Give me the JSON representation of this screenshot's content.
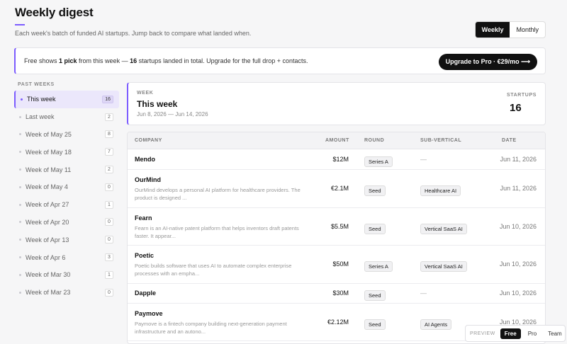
{
  "header": {
    "title": "Weekly digest",
    "subtitle": "Each week's batch of funded AI startups. Jump back to compare what landed when."
  },
  "period_toggle": {
    "weekly": "Weekly",
    "monthly": "Monthly",
    "active": "Weekly"
  },
  "banner": {
    "pre": "Free shows ",
    "bold1": "1 pick",
    "mid": " from this week — ",
    "bold2": "16",
    "post": " startups landed in total. Upgrade for the full drop + contacts.",
    "button": "Upgrade to Pro · €29/mo ⟶"
  },
  "sidebar": {
    "heading": "PAST WEEKS",
    "items": [
      {
        "label": "This week",
        "count": "16"
      },
      {
        "label": "Last week",
        "count": "2"
      },
      {
        "label": "Week of May 25",
        "count": "8"
      },
      {
        "label": "Week of May 18",
        "count": "7"
      },
      {
        "label": "Week of May 11",
        "count": "2"
      },
      {
        "label": "Week of May 4",
        "count": "0"
      },
      {
        "label": "Week of Apr 27",
        "count": "1"
      },
      {
        "label": "Week of Apr 20",
        "count": "0"
      },
      {
        "label": "Week of Apr 13",
        "count": "0"
      },
      {
        "label": "Week of Apr 6",
        "count": "3"
      },
      {
        "label": "Week of Mar 30",
        "count": "1"
      },
      {
        "label": "Week of Mar 23",
        "count": "0"
      }
    ]
  },
  "week_card": {
    "label": "WEEK",
    "title": "This week",
    "range": "Jun 8, 2026 — Jun 14, 2026",
    "stat_label": "STARTUPS",
    "stat_value": "16"
  },
  "table": {
    "headers": {
      "company": "COMPANY",
      "amount": "AMOUNT",
      "round": "ROUND",
      "subvertical": "SUB-VERTICAL",
      "date": "DATE"
    },
    "rows": [
      {
        "name": "Mendo",
        "desc": "",
        "amount": "$12M",
        "round": "Series A",
        "subvertical": "—",
        "date": "Jun 11, 2026"
      },
      {
        "name": "OurMind",
        "desc": "OurMind develops a personal AI platform for healthcare providers. The product is designed ...",
        "amount": "€2.1M",
        "round": "Seed",
        "subvertical": "Healthcare AI",
        "date": "Jun 11, 2026"
      },
      {
        "name": "Fearn",
        "desc": "Fearn is an AI-native patent platform that helps inventors draft patents faster. It appear...",
        "amount": "$5.5M",
        "round": "Seed",
        "subvertical": "Vertical SaaS AI",
        "date": "Jun 10, 2026"
      },
      {
        "name": "Poetic",
        "desc": "Poetic builds software that uses AI to automate complex enterprise processes with an empha...",
        "amount": "$50M",
        "round": "Series A",
        "subvertical": "Vertical SaaS AI",
        "date": "Jun 10, 2026"
      },
      {
        "name": "Dapple",
        "desc": "",
        "amount": "$30M",
        "round": "Seed",
        "subvertical": "—",
        "date": "Jun 10, 2026"
      },
      {
        "name": "Paymove",
        "desc": "Paymove is a fintech company building next-generation payment infrastructure and an autono...",
        "amount": "€2.12M",
        "round": "Seed",
        "subvertical": "AI Agents",
        "date": "Jun 10, 2026"
      }
    ]
  },
  "preview": {
    "label": "PREVIEW",
    "options": [
      "Free",
      "Pro",
      "Team"
    ],
    "active": "Free"
  },
  "colors": {
    "accent": "#7c5cff",
    "dark": "#111111"
  }
}
